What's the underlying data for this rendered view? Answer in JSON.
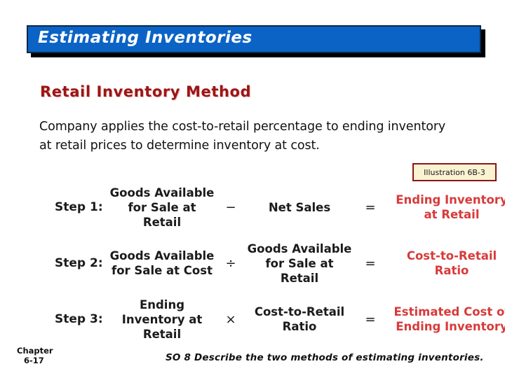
{
  "slide": {
    "title": "Estimating Inventories",
    "title_bar_color": "#0B63C5",
    "heading": "Retail Inventory Method",
    "heading_color": "#9C1515",
    "body": "Company applies the cost-to-retail percentage to ending inventory at retail prices to determine inventory at cost.",
    "illustration_tag": "Illustration 6B-3",
    "result_color": "#D83A3A"
  },
  "diagram": {
    "rows": [
      {
        "step": "Step 1:",
        "term1": "Goods Available for Sale at Retail",
        "operator": "−",
        "term2": "Net Sales",
        "equals": "=",
        "result": "Ending Inventory at Retail"
      },
      {
        "step": "Step 2:",
        "term1": "Goods Available for Sale at Cost",
        "operator": "÷",
        "term2": "Goods Available for Sale at Retail",
        "equals": "=",
        "result": "Cost-to-Retail Ratio"
      },
      {
        "step": "Step 3:",
        "term1": "Ending Inventory at Retail",
        "operator": "×",
        "term2": "Cost-to-Retail Ratio",
        "equals": "=",
        "result": "Estimated Cost of Ending Inventory"
      }
    ]
  },
  "footer": {
    "chapter_label": "Chapter",
    "chapter_number": "6-17",
    "objective": "SO 8  Describe the two methods of estimating inventories."
  }
}
